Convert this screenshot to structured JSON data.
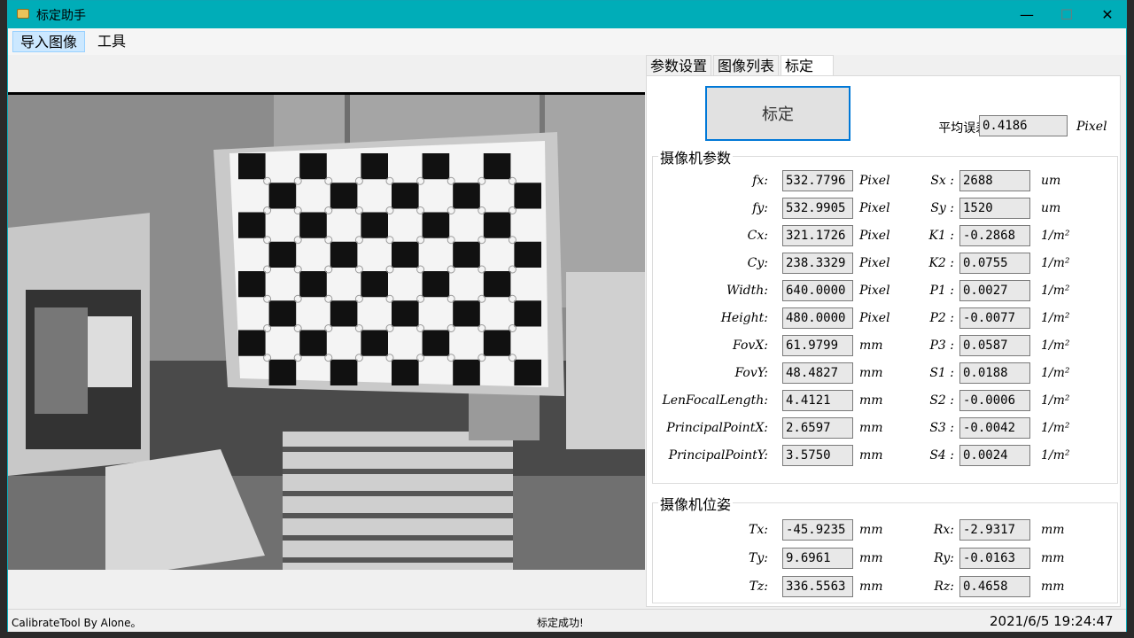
{
  "window": {
    "title": "标定助手",
    "minimize": "—",
    "maximize": "☐",
    "close": "✕"
  },
  "menu": {
    "import_image": "导入图像",
    "tools": "工具"
  },
  "tabs": [
    "参数设置",
    "图像列表",
    "标定"
  ],
  "calibrate_button": "标定",
  "avg_error": {
    "label": "平均误差:",
    "value": "0.4186",
    "unit": "Pixel"
  },
  "camera_params": {
    "title": "摄像机参数",
    "left": [
      {
        "label": "fx:",
        "value": "532.7796",
        "unit": "Pixel"
      },
      {
        "label": "fy:",
        "value": "532.9905",
        "unit": "Pixel"
      },
      {
        "label": "Cx:",
        "value": "321.1726",
        "unit": "Pixel"
      },
      {
        "label": "Cy:",
        "value": "238.3329",
        "unit": "Pixel"
      },
      {
        "label": "Width:",
        "value": "640.0000",
        "unit": "Pixel"
      },
      {
        "label": "Height:",
        "value": "480.0000",
        "unit": "Pixel"
      },
      {
        "label": "FovX:",
        "value": "61.9799",
        "unit": "mm"
      },
      {
        "label": "FovY:",
        "value": "48.4827",
        "unit": "mm"
      },
      {
        "label": "LenFocalLength:",
        "value": "4.4121",
        "unit": "mm"
      },
      {
        "label": "PrincipalPointX:",
        "value": "2.6597",
        "unit": "mm"
      },
      {
        "label": "PrincipalPointY:",
        "value": "3.5750",
        "unit": "mm"
      }
    ],
    "right": [
      {
        "label": "Sx :",
        "value": "2688",
        "unit": "um"
      },
      {
        "label": "Sy :",
        "value": "1520",
        "unit": "um"
      },
      {
        "label": "K1 :",
        "value": "-0.2868",
        "unit": "1/m²"
      },
      {
        "label": "K2 :",
        "value": "0.0755",
        "unit": "1/m²"
      },
      {
        "label": "P1 :",
        "value": "0.0027",
        "unit": "1/m²"
      },
      {
        "label": "P2 :",
        "value": "-0.0077",
        "unit": "1/m²"
      },
      {
        "label": "P3 :",
        "value": "0.0587",
        "unit": "1/m²"
      },
      {
        "label": "S1 :",
        "value": "0.0188",
        "unit": "1/m²"
      },
      {
        "label": "S2 :",
        "value": "-0.0006",
        "unit": "1/m²"
      },
      {
        "label": "S3 :",
        "value": "-0.0042",
        "unit": "1/m²"
      },
      {
        "label": "S4 :",
        "value": "0.0024",
        "unit": "1/m²"
      }
    ]
  },
  "camera_pose": {
    "title": "摄像机位姿",
    "left": [
      {
        "label": "Tx:",
        "value": "-45.9235",
        "unit": "mm"
      },
      {
        "label": "Ty:",
        "value": "9.6961",
        "unit": "mm"
      },
      {
        "label": "Tz:",
        "value": "336.5563",
        "unit": "mm"
      }
    ],
    "right": [
      {
        "label": "Rx:",
        "value": "-2.9317",
        "unit": "mm"
      },
      {
        "label": "Ry:",
        "value": "-0.0163",
        "unit": "mm"
      },
      {
        "label": "Rz:",
        "value": "0.4658",
        "unit": "mm"
      }
    ]
  },
  "status": {
    "left": "CalibrateTool By Alone。",
    "center": "标定成功!",
    "datetime": "2021/6/5 19:24:47"
  }
}
